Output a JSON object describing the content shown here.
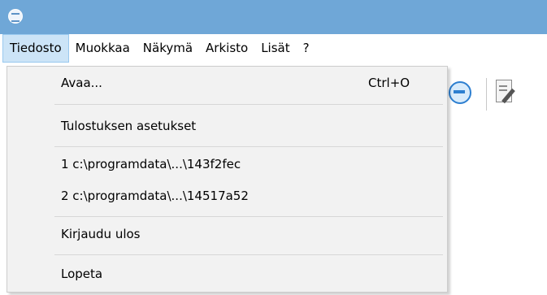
{
  "window": {
    "icon": "app-logo-icon"
  },
  "menubar": {
    "items": [
      {
        "label": "Tiedosto"
      },
      {
        "label": "Muokkaa"
      },
      {
        "label": "Näkymä"
      },
      {
        "label": "Arkisto"
      },
      {
        "label": "Lisät"
      },
      {
        "label": "?"
      }
    ]
  },
  "file_menu": {
    "open_label": "Avaa...",
    "open_shortcut": "Ctrl+O",
    "print_setup_label": "Tulostuksen asetukset",
    "recent_1": "1 c:\\programdata\\...\\143f2fec",
    "recent_2": "2 c:\\programdata\\...\\14517a52",
    "logout_label": "Kirjaudu ulos",
    "exit_label": "Lopeta"
  },
  "toolbar": {
    "icons": [
      "sync-icon",
      "document-edit-icon"
    ]
  }
}
